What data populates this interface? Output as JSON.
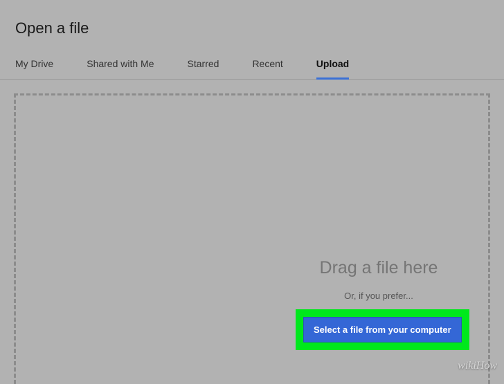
{
  "dialog": {
    "title": "Open a file"
  },
  "tabs": {
    "my_drive": "My Drive",
    "shared": "Shared with Me",
    "starred": "Starred",
    "recent": "Recent",
    "upload": "Upload"
  },
  "dropzone": {
    "drag_text": "Drag a file here",
    "or_text": "Or, if you prefer...",
    "button_label": "Select a file from your computer"
  },
  "watermark": "wikiHow"
}
